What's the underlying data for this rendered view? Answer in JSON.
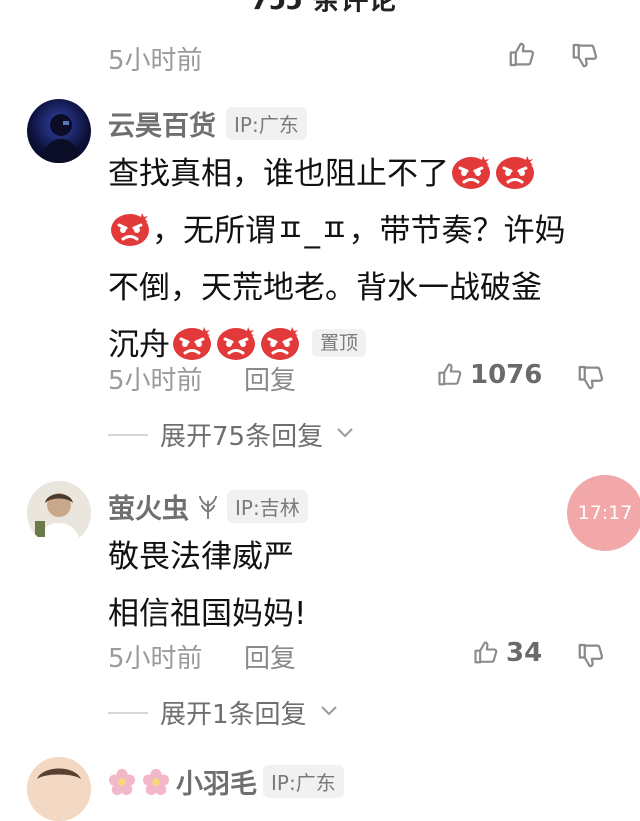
{
  "top_cut_text": "7ɔɔ 条评论",
  "first_meta": {
    "time": "5小时前"
  },
  "comments": [
    {
      "username": "云昊百货",
      "ip": "IP:广东",
      "line1": "查找真相，谁也阻止不了",
      "line2": "，无所谓ㅍ_ㅍ，带节奏？许妈",
      "line3": "不倒，天荒地老。背水一战破釜",
      "line4": "沉舟",
      "pin_label": "置顶",
      "time": "5小时前",
      "reply_label": "回复",
      "like_count": "1076",
      "expand_label": "展开75条回复"
    },
    {
      "username": "萤火虫",
      "ip": "IP:吉林",
      "line1": "敬畏法律威严",
      "line2": "相信祖国妈妈!",
      "time": "5小时前",
      "reply_label": "回复",
      "like_count": "34",
      "expand_label": "展开1条回复"
    },
    {
      "username": "小羽毛",
      "ip": "IP:广东"
    }
  ],
  "time_bubble": "17:17",
  "icons": [
    "thumb-up-icon",
    "thumb-down-icon",
    "angry-emoji-icon",
    "chevron-down-icon",
    "firefly-badge-icon",
    "flower-icon"
  ],
  "colors": {
    "meta_gray": "#9a9a9a",
    "bubble": "#f2a8a8",
    "emoji_red": "#e23a3a"
  }
}
